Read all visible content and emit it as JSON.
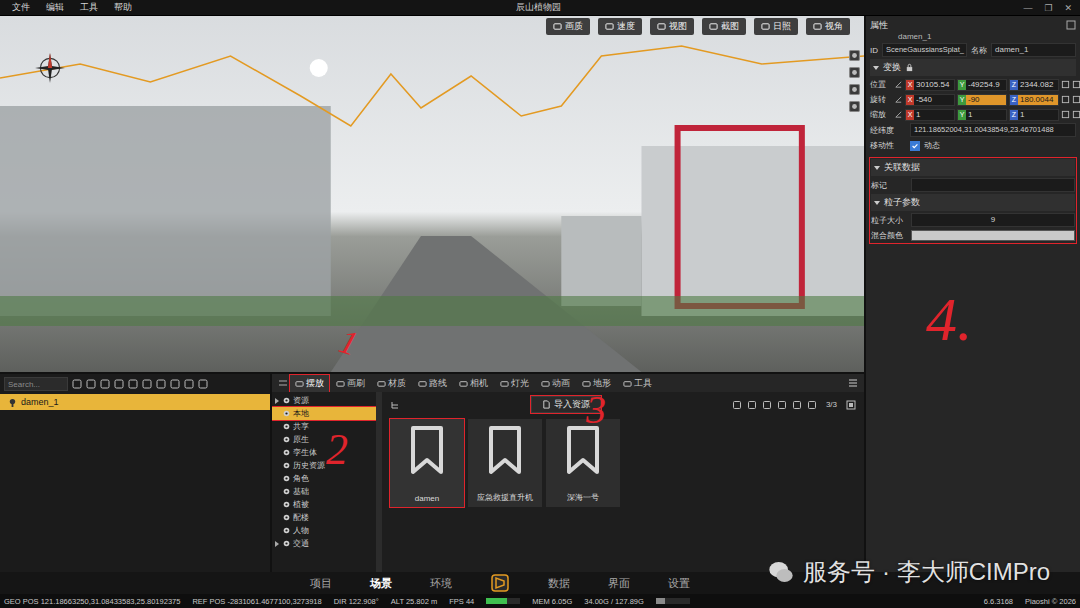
{
  "window": {
    "title": "辰山植物园",
    "menu": [
      "文件",
      "编辑",
      "工具",
      "帮助"
    ],
    "controls": [
      "—",
      "❐",
      "✕"
    ]
  },
  "viewport": {
    "toolbar": [
      "画质",
      "速度",
      "视图",
      "截图",
      "日照",
      "视角"
    ]
  },
  "outliner": {
    "search_placeholder": "Search...",
    "items": [
      {
        "label": "damen_1",
        "selected": true
      }
    ]
  },
  "assets": {
    "tabs": [
      {
        "label": "摆放",
        "selected": true,
        "marked": true
      },
      {
        "label": "画刷",
        "selected": false,
        "marked": false
      },
      {
        "label": "材质",
        "selected": false,
        "marked": false
      },
      {
        "label": "路线",
        "selected": false,
        "marked": false
      },
      {
        "label": "相机",
        "selected": false,
        "marked": false
      },
      {
        "label": "灯光",
        "selected": false,
        "marked": false
      },
      {
        "label": "动画",
        "selected": false,
        "marked": false
      },
      {
        "label": "地形",
        "selected": false,
        "marked": false
      },
      {
        "label": "工具",
        "selected": false,
        "marked": false
      }
    ],
    "categories": [
      {
        "label": "资源",
        "expandable": true,
        "selected": false,
        "marked": false
      },
      {
        "label": "本地",
        "expandable": false,
        "selected": true,
        "marked": true
      },
      {
        "label": "共享",
        "expandable": false,
        "selected": false,
        "marked": false
      },
      {
        "label": "原生",
        "expandable": false,
        "selected": false,
        "marked": false
      },
      {
        "label": "孪生体",
        "expandable": false,
        "selected": false,
        "marked": false
      },
      {
        "label": "历史资源",
        "expandable": false,
        "selected": false,
        "marked": false
      },
      {
        "label": "角色",
        "expandable": false,
        "selected": false,
        "marked": false
      },
      {
        "label": "基础",
        "expandable": false,
        "selected": false,
        "marked": false
      },
      {
        "label": "植被",
        "expandable": false,
        "selected": false,
        "marked": false
      },
      {
        "label": "配楼",
        "expandable": false,
        "selected": false,
        "marked": false
      },
      {
        "label": "人物",
        "expandable": false,
        "selected": false,
        "marked": false
      },
      {
        "label": "交通",
        "expandable": true,
        "selected": false,
        "marked": false
      }
    ],
    "import_button": {
      "label": "导入资源",
      "marked": true
    },
    "count": "3/3",
    "cards": [
      {
        "label": "damen",
        "selected": true,
        "marked": true
      },
      {
        "label": "应急救援直升机",
        "selected": false,
        "marked": false
      },
      {
        "label": "深海一号",
        "selected": false,
        "marked": false
      }
    ]
  },
  "properties": {
    "title": "属性",
    "object": "damen_1",
    "id": {
      "label": "ID",
      "value": "SceneGaussiansSplat_"
    },
    "name": {
      "label": "名称",
      "value": "damen_1"
    },
    "transform": {
      "title": "变换",
      "expanded": true,
      "rows": [
        {
          "label": "位置",
          "axes": [
            {
              "axis": "X",
              "value": "30105.54",
              "highlighted": false,
              "color": "#c0392b"
            },
            {
              "axis": "Y",
              "value": "-49254.9",
              "highlighted": false,
              "color": "#3e9a3e"
            },
            {
              "axis": "Z",
              "value": "2344.082",
              "highlighted": false,
              "color": "#3a62c4"
            }
          ]
        },
        {
          "label": "旋转",
          "axes": [
            {
              "axis": "X",
              "value": "-540",
              "highlighted": false,
              "color": "#c0392b"
            },
            {
              "axis": "Y",
              "value": "-90",
              "highlighted": true,
              "color": "#3e9a3e"
            },
            {
              "axis": "Z",
              "value": "180.0044",
              "highlighted": true,
              "color": "#3a62c4"
            }
          ]
        },
        {
          "label": "缩放",
          "axes": [
            {
              "axis": "X",
              "value": "1",
              "highlighted": false,
              "color": "#c0392b"
            },
            {
              "axis": "Y",
              "value": "1",
              "highlighted": false,
              "color": "#3e9a3e"
            },
            {
              "axis": "Z",
              "value": "1",
              "highlighted": false,
              "color": "#3a62c4"
            }
          ]
        }
      ],
      "geo": {
        "label": "经纬度",
        "value": "121.18652004,31.00438549,23.46701488"
      },
      "mobility": {
        "label": "移动性",
        "option": "动态",
        "checked": true
      }
    },
    "marked": true,
    "linked": {
      "title": "关联数据",
      "expanded": true,
      "fields": [
        {
          "label": "标记",
          "value": ""
        }
      ]
    },
    "particles": {
      "title": "粒子参数",
      "expanded": true,
      "size": {
        "label": "粒子大小",
        "value": "9"
      },
      "blend": {
        "label": "混合颜色",
        "color": "#c9c9c9"
      }
    }
  },
  "nav": [
    {
      "label": "项目",
      "selected": false
    },
    {
      "label": "场景",
      "selected": true
    },
    {
      "label": "环境",
      "selected": false
    },
    {
      "label": "数据",
      "selected": false
    },
    {
      "label": "界面",
      "selected": false
    },
    {
      "label": "设置",
      "selected": false
    }
  ],
  "status_bar": [
    {
      "kind": "text",
      "text": "GEO POS 121.18663250,31.08433583,25.80192375"
    },
    {
      "kind": "text",
      "text": "REF POS -2831061.4677100,3273918"
    },
    {
      "kind": "text",
      "text": "DIR 122.908°"
    },
    {
      "kind": "text",
      "text": "ALT 25.802 m"
    },
    {
      "kind": "text",
      "text": "FPS 44"
    },
    {
      "kind": "meter",
      "level": 0.6,
      "color": "#3fbf4f"
    },
    {
      "kind": "text",
      "text": "MEM 6.05G"
    },
    {
      "kind": "text",
      "text": "34.00G / 127.89G"
    },
    {
      "kind": "meter",
      "level": 0.27,
      "color": "#8a8a8a"
    },
    {
      "kind": "right",
      "text": "6.6.3168"
    },
    {
      "kind": "right",
      "text": "Piaoshi © 2026"
    }
  ],
  "watermark": "服务号 · 李大师CIMPro",
  "annotations": [
    "1",
    "2",
    "3",
    "4."
  ]
}
